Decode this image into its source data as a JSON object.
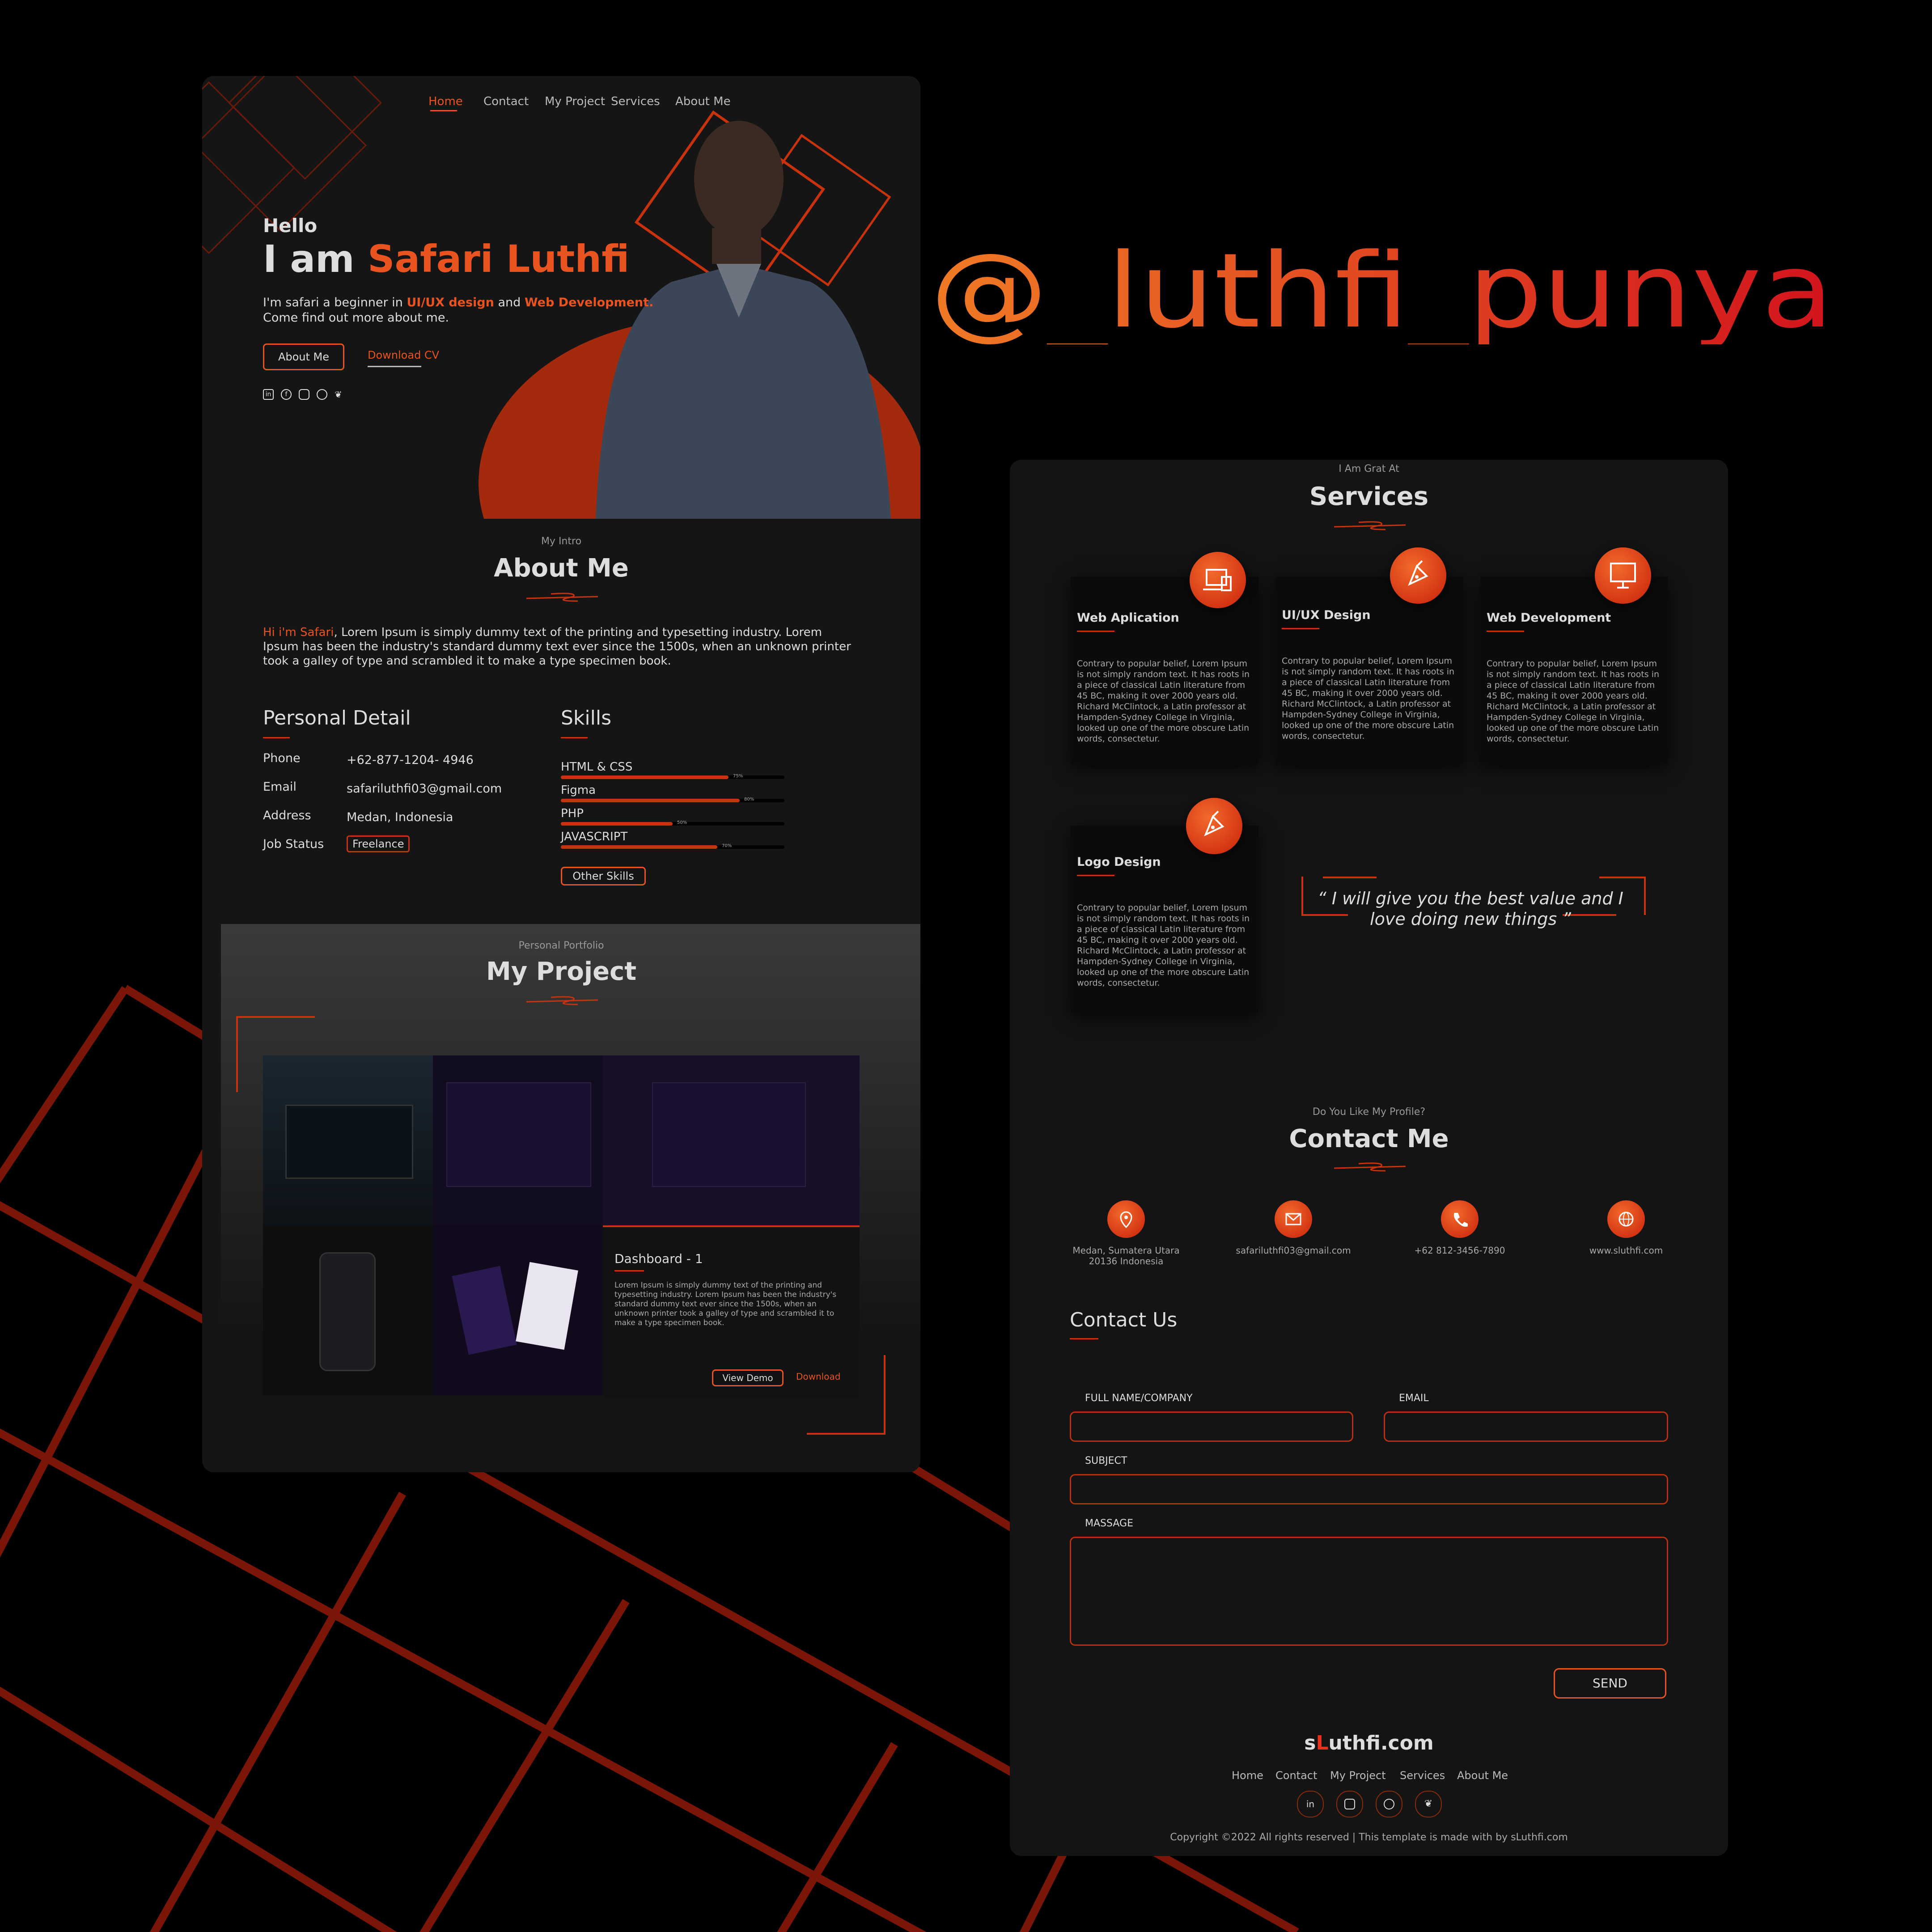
{
  "handle": "@_luthfi_punya",
  "colors": {
    "accent": "#e8531f",
    "dark": "#151515"
  },
  "left": {
    "nav": [
      "Home",
      "Contact",
      "My Project",
      "Services",
      "About Me"
    ],
    "hero": {
      "hello": "Hello",
      "name_prefix": "I am ",
      "name": "Safari Luthfi",
      "sub_1": "I'm safari a beginner in ",
      "sub_hl1": "UI/UX design",
      "sub_2": " and ",
      "sub_hl2": "Web Development.",
      "sub_3": "Come find out more about me.",
      "btn_about": "About Me",
      "btn_cv": "Download CV",
      "social_icons": [
        "linkedin-icon",
        "facebook-icon",
        "instagram-icon",
        "github-icon",
        "twitter-icon"
      ]
    },
    "about": {
      "label": "My Intro",
      "title": "About Me",
      "hi": "Hi i'm Safari",
      "text": ", Lorem Ipsum is simply dummy text of the printing and typesetting industry. Lorem Ipsum has been the industry's standard dummy text ever since the 1500s, when an unknown printer took a galley of type and scrambled it to make a type specimen book."
    },
    "personal": {
      "title": "Personal Detail",
      "rows": [
        {
          "k": "Phone",
          "v": "+62-877-1204- 4946"
        },
        {
          "k": "Email",
          "v": "safariluthfi03@gmail.com"
        },
        {
          "k": "Address",
          "v": "Medan, Indonesia"
        },
        {
          "k": "Job Status",
          "v": "Freelance"
        }
      ]
    },
    "skills": {
      "title": "Skills",
      "items": [
        {
          "name": "HTML & CSS",
          "pct": 75,
          "label": "75%"
        },
        {
          "name": "Figma",
          "pct": 80,
          "label": "80%"
        },
        {
          "name": "PHP",
          "pct": 50,
          "label": "50%"
        },
        {
          "name": "JAVASCRIPT",
          "pct": 70,
          "label": "70%"
        }
      ],
      "other": "Other Skills"
    },
    "project": {
      "label": "Personal Portfolio",
      "title": "My Project",
      "card_title": "Dashboard - 1",
      "card_text": "Lorem Ipsum is simply dummy text of the printing and typesetting industry. Lorem Ipsum has been the industry's standard dummy text ever since the 1500s, when an unknown printer took a galley of type and scrambled it to make a type specimen book.",
      "btn_demo": "View Demo",
      "btn_download": "Download"
    }
  },
  "right": {
    "services": {
      "label": "I Am Grat At",
      "title": "Services",
      "cards": [
        {
          "title": "Web Aplication",
          "icon": "devices-icon"
        },
        {
          "title": "UI/UX Design",
          "icon": "pen-tool-icon"
        },
        {
          "title": "Web Development",
          "icon": "monitor-code-icon"
        },
        {
          "title": "Logo Design",
          "icon": "pen-nib-icon"
        }
      ],
      "card_text": "Contrary to popular belief, Lorem Ipsum is not simply random text. It has roots in a piece of classical Latin literature from 45 BC, making it over 2000 years old. Richard McClintock, a Latin professor at Hampden-Sydney College in Virginia, looked up one of the more obscure Latin words, consectetur.",
      "quote": "“ I will give you the best value and I love doing new things ”"
    },
    "contact": {
      "label": "Do You Like My Profile?",
      "title": "Contact Me",
      "items": [
        {
          "icon": "location-pin-icon",
          "line1": "Medan, Sumatera Utara",
          "line2": "20136 Indonesia"
        },
        {
          "icon": "mail-icon",
          "line1": "safariluthfi03@gmail.com",
          "line2": ""
        },
        {
          "icon": "phone-icon",
          "line1": "+62 812-3456-7890",
          "line2": ""
        },
        {
          "icon": "globe-icon",
          "line1": "www.sluthfi.com",
          "line2": ""
        }
      ]
    },
    "form": {
      "title": "Contact Us",
      "name_label": "FULL NAME/COMPANY",
      "email_label": "EMAIL",
      "subject_label": "SUBJECT",
      "message_label": "MASSAGE",
      "send": "SEND"
    },
    "footer": {
      "logo_s": "s",
      "logo_l": "L",
      "logo_rest": "uthfi.com",
      "nav": [
        "Home",
        "Contact",
        "My Project",
        "Services",
        "About Me"
      ],
      "social_icons": [
        "linkedin-icon",
        "instagram-icon",
        "github-icon",
        "twitter-icon"
      ],
      "copyright": "Copyright ©2022 All rights reserved | This template is made with by sLuthfi.com"
    }
  }
}
